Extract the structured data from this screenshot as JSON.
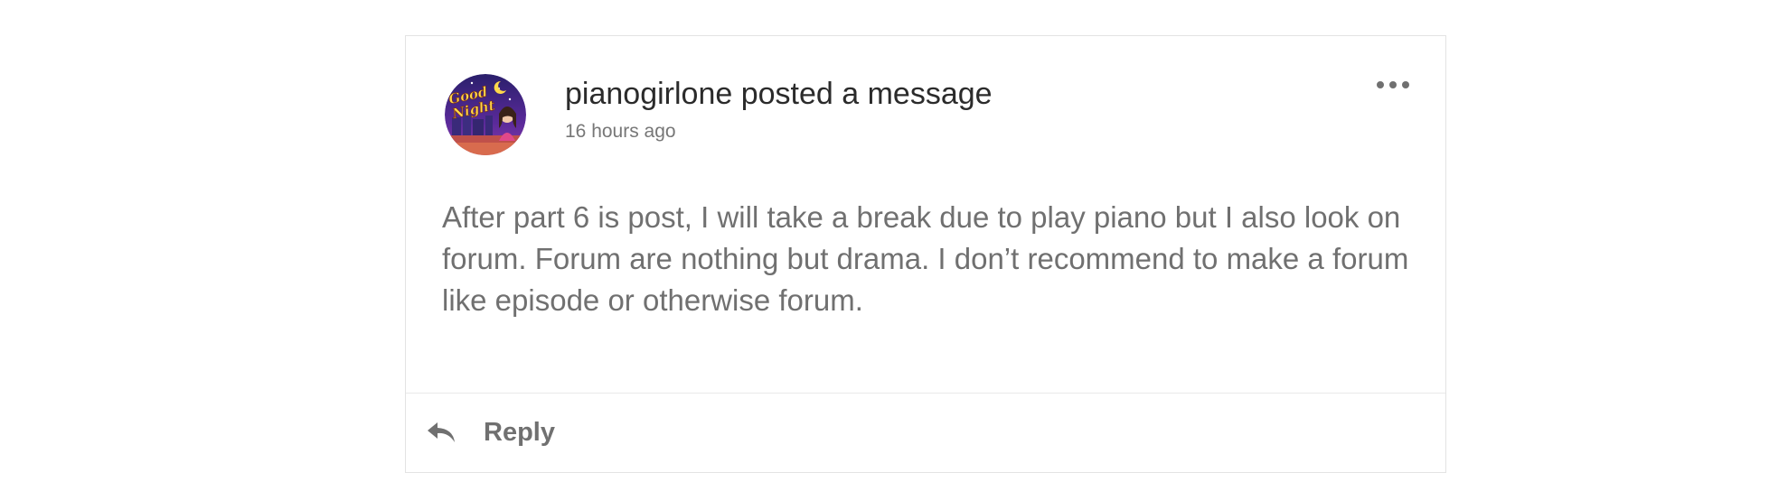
{
  "post": {
    "author": "pianogirlone",
    "headline": "pianogirlone posted a message",
    "timestamp": "16 hours ago",
    "body": "After part 6 is post, I will take a break due to play piano but I also look on forum. Forum are nothing but drama.  I don’t recommend to make a forum like episode or otherwise forum.",
    "avatar_text": [
      "Good",
      "Night"
    ]
  },
  "actions": {
    "more_icon": "ellipsis-icon",
    "reply_icon": "reply-arrow-icon",
    "reply_label": "Reply"
  },
  "colors": {
    "headline": "#2b2b2b",
    "secondary_text": "#707070",
    "border": "#e3e3e3"
  }
}
